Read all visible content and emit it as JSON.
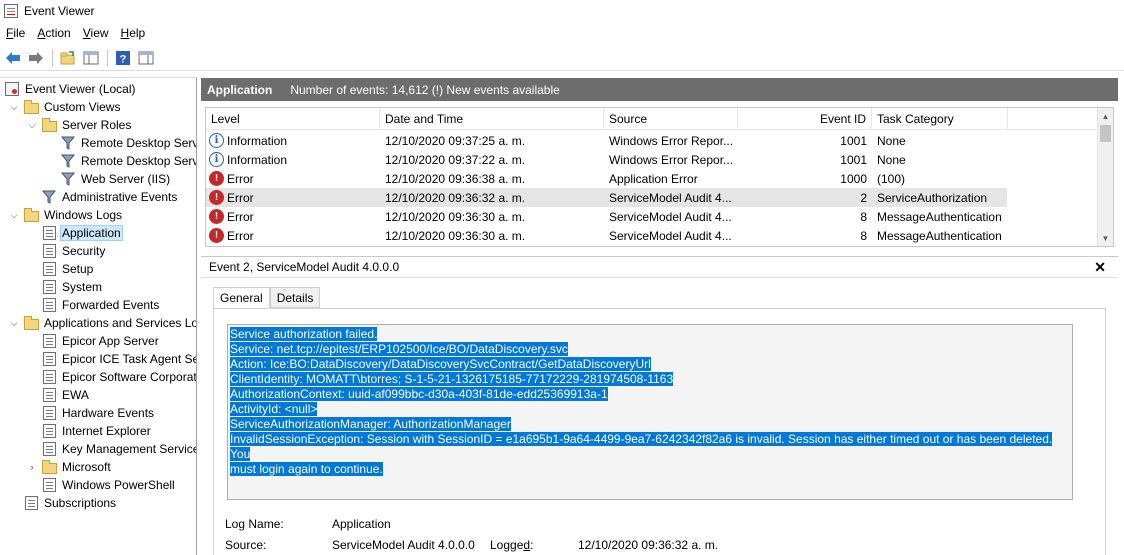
{
  "window": {
    "title": "Event Viewer"
  },
  "menu": [
    {
      "pre": "",
      "ul": "F",
      "post": "ile"
    },
    {
      "pre": "",
      "ul": "A",
      "post": "ction"
    },
    {
      "pre": "",
      "ul": "V",
      "post": "iew"
    },
    {
      "pre": "",
      "ul": "H",
      "post": "elp"
    }
  ],
  "toolbar": {
    "icons": [
      "back-icon",
      "forward-icon",
      "open-folder-icon",
      "show-hide-pane-icon",
      "help-icon",
      "properties-pane-icon"
    ]
  },
  "tree": {
    "items": [
      {
        "label": "Event Viewer (Local)",
        "icon": "event-viewer-icon"
      },
      {
        "label": "Custom Views",
        "icon": "folder-icon"
      },
      {
        "label": "Server Roles",
        "icon": "folder-icon"
      },
      {
        "label": "Remote Desktop Servi",
        "icon": "filter-icon"
      },
      {
        "label": "Remote Desktop Servi",
        "icon": "filter-icon"
      },
      {
        "label": "Web Server (IIS)",
        "icon": "filter-icon"
      },
      {
        "label": "Administrative Events",
        "icon": "filter-icon"
      },
      {
        "label": "Windows Logs",
        "icon": "folder-icon"
      },
      {
        "label": "Application",
        "icon": "log-icon"
      },
      {
        "label": "Security",
        "icon": "log-icon"
      },
      {
        "label": "Setup",
        "icon": "log-icon"
      },
      {
        "label": "System",
        "icon": "log-icon"
      },
      {
        "label": "Forwarded Events",
        "icon": "log-icon"
      },
      {
        "label": "Applications and Services Lo",
        "icon": "folder-icon"
      },
      {
        "label": "Epicor App Server",
        "icon": "log-icon"
      },
      {
        "label": "Epicor ICE Task Agent Ser",
        "icon": "log-icon"
      },
      {
        "label": "Epicor Software Corporati",
        "icon": "log-icon"
      },
      {
        "label": "EWA",
        "icon": "log-icon"
      },
      {
        "label": "Hardware Events",
        "icon": "log-icon"
      },
      {
        "label": "Internet Explorer",
        "icon": "log-icon"
      },
      {
        "label": "Key Management Service",
        "icon": "log-icon"
      },
      {
        "label": "Microsoft",
        "icon": "folder-icon"
      },
      {
        "label": "Windows PowerShell",
        "icon": "log-icon"
      },
      {
        "label": "Subscriptions",
        "icon": "log-icon"
      }
    ]
  },
  "events_header": {
    "title": "Application",
    "summary": "Number of events: 14,612 (!) New events available"
  },
  "grid": {
    "columns": [
      "Level",
      "Date and Time",
      "Source",
      "Event ID",
      "Task Category"
    ],
    "rows": [
      {
        "level": "Information",
        "datetime": "12/10/2020 09:37:25 a. m.",
        "source": "Windows Error Repor...",
        "event_id": "1001",
        "task": "None"
      },
      {
        "level": "Information",
        "datetime": "12/10/2020 09:37:22 a. m.",
        "source": "Windows Error Repor...",
        "event_id": "1001",
        "task": "None"
      },
      {
        "level": "Error",
        "datetime": "12/10/2020 09:36:38 a. m.",
        "source": "Application Error",
        "event_id": "1000",
        "task": "(100)"
      },
      {
        "level": "Error",
        "datetime": "12/10/2020 09:36:32 a. m.",
        "source": "ServiceModel Audit 4...",
        "event_id": "2",
        "task": "ServiceAuthorization"
      },
      {
        "level": "Error",
        "datetime": "12/10/2020 09:36:30 a. m.",
        "source": "ServiceModel Audit 4...",
        "event_id": "8",
        "task": "MessageAuthentication"
      },
      {
        "level": "Error",
        "datetime": "12/10/2020 09:36:30 a. m.",
        "source": "ServiceModel Audit 4...",
        "event_id": "8",
        "task": "MessageAuthentication"
      }
    ]
  },
  "detail": {
    "title": "Event 2, ServiceModel Audit 4.0.0.0",
    "tabs": [
      "General",
      "Details"
    ],
    "message_lines": [
      "Service authorization failed.",
      "Service: net.tcp://epitest/ERP102500/Ice/BO/DataDiscovery.svc",
      "Action: Ice:BO:DataDiscovery/DataDiscoverySvcContract/GetDataDiscoveryUrl",
      "ClientIdentity: MOMATT\\btorres; S-1-5-21-1326175185-77172229-281974508-1163",
      "AuthorizationContext: uuid-af099bbc-d30a-403f-81de-edd25369913a-1",
      "ActivityId: <null>",
      "ServiceAuthorizationManager: AuthorizationManager",
      "InvalidSessionException: Session with SessionID = e1a695b1-9a64-4499-9ea7-6242342f82a6 is invalid. Session has either timed out or has been deleted. You",
      "must login again to continue."
    ],
    "log_name_label": "Log Name:",
    "log_name": "Application",
    "source_label": "Source:",
    "source": "ServiceModel Audit 4.0.0.0",
    "logged_label_pre": "Logge",
    "logged_label_ul": "d",
    "logged_label_post": ":",
    "logged": "12/10/2020 09:36:32 a. m."
  }
}
